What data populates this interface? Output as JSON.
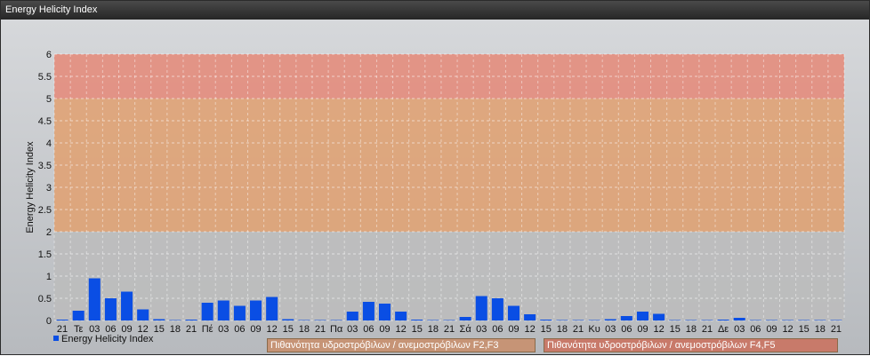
{
  "window": {
    "title": "Energy Helicity Index"
  },
  "chart_data": {
    "type": "bar",
    "ylabel": "Energy Helicity Index",
    "ylim": [
      0,
      6
    ],
    "yticks": [
      "0",
      "0.5",
      "1",
      "1.5",
      "2",
      "2.5",
      "3",
      "3.5",
      "4",
      "4.5",
      "5",
      "5.5",
      "6"
    ],
    "grid": true,
    "bands": [
      {
        "from": 0,
        "to": 2,
        "color": "#bcbcbc"
      },
      {
        "from": 2,
        "to": 5,
        "color": "#e0a070"
      },
      {
        "from": 5,
        "to": 6,
        "color": "#e58878"
      }
    ],
    "categories": [
      "21",
      "Τε",
      "03",
      "06",
      "09",
      "12",
      "15",
      "18",
      "21",
      "Πέ",
      "03",
      "06",
      "09",
      "12",
      "15",
      "18",
      "21",
      "Πα",
      "03",
      "06",
      "09",
      "12",
      "15",
      "18",
      "21",
      "Σά",
      "03",
      "06",
      "09",
      "12",
      "15",
      "18",
      "21",
      "Κυ",
      "03",
      "06",
      "09",
      "12",
      "15",
      "18",
      "21",
      "Δε",
      "03",
      "06",
      "09",
      "12",
      "15",
      "18",
      "21"
    ],
    "series": [
      {
        "name": "Energy Helicity Index",
        "color": "#0a4ee4",
        "values": [
          0.02,
          0.22,
          0.95,
          0.5,
          0.65,
          0.25,
          0.03,
          0.01,
          0.02,
          0.4,
          0.45,
          0.33,
          0.45,
          0.53,
          0.03,
          0.01,
          0.01,
          0.01,
          0.2,
          0.42,
          0.38,
          0.2,
          0.02,
          0.01,
          0.01,
          0.08,
          0.55,
          0.5,
          0.33,
          0.14,
          0.02,
          0.01,
          0.01,
          0.01,
          0.03,
          0.1,
          0.2,
          0.15,
          0.01,
          0.01,
          0.01,
          0.02,
          0.06,
          0.01,
          0.01,
          0.01,
          0.01,
          0.01,
          0.01
        ]
      }
    ],
    "legend": "bottom-left",
    "band_labels": [
      "Πιθανότητα υδροστρόβιλων / ανεμοστρόβιλων F2,F3",
      "Πιθανότητα υδροστρόβιλων / ανεμοστρόβιλων F4,F5"
    ]
  }
}
